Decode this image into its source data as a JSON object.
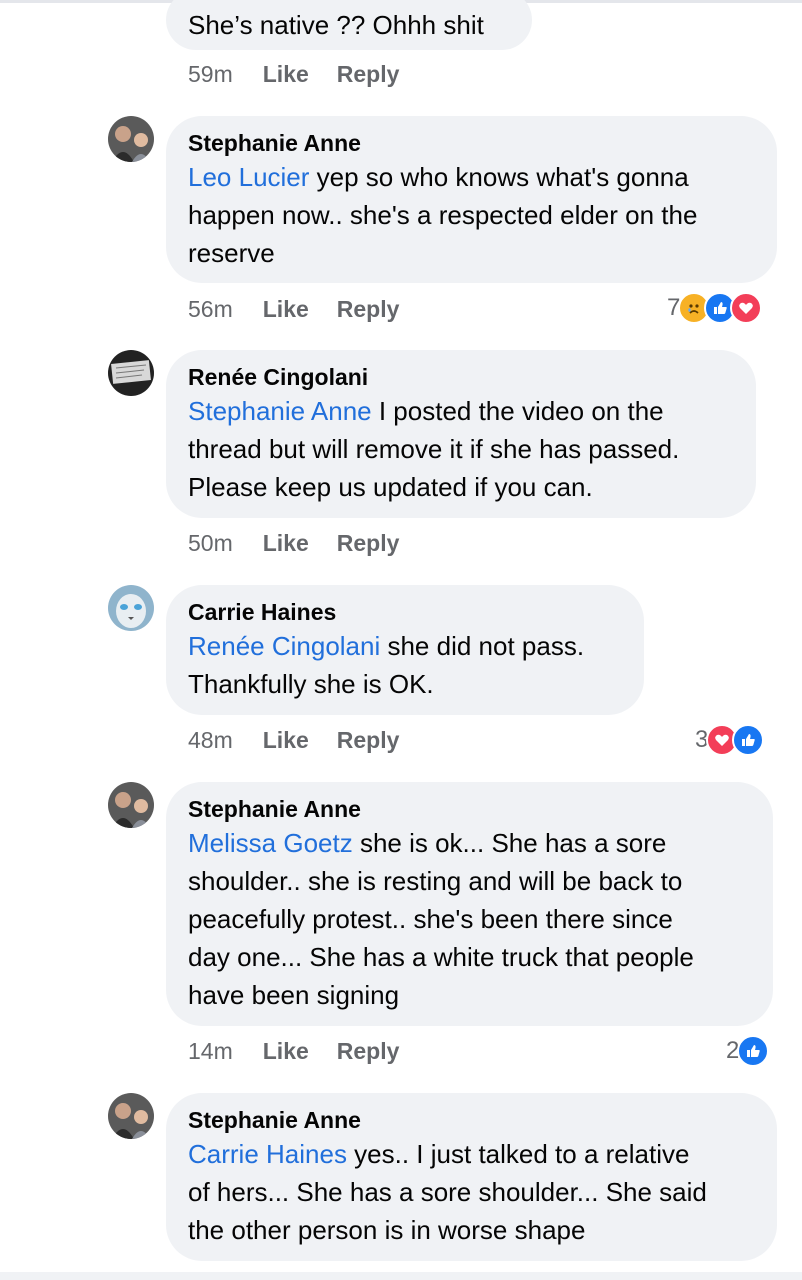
{
  "comments": [
    {
      "author": "",
      "mention": "",
      "text": "She’s native ?? Ohhh shit",
      "time": "59m",
      "like": "Like",
      "reply": "Reply",
      "reaction_count": ""
    },
    {
      "author": "Stephanie Anne",
      "mention": "Leo Lucier",
      "text_lines": [
        " yep so who knows what's gonna",
        "happen now.. she's a respected elder on the",
        "reserve"
      ],
      "time": "56m",
      "like": "Like",
      "reply": "Reply",
      "reaction_count": "7",
      "reaction_icons": [
        "sad-react-icon",
        "like-react-icon",
        "love-react-icon"
      ]
    },
    {
      "author": "Renée Cingolani",
      "mention": "Stephanie Anne",
      "text_lines": [
        " I posted the video on the",
        "thread but will remove it if she has passed.",
        "Please keep us updated if you can."
      ],
      "time": "50m",
      "like": "Like",
      "reply": "Reply",
      "reaction_count": ""
    },
    {
      "author": "Carrie Haines",
      "mention": "Renée Cingolani",
      "text_lines": [
        " she did not pass.",
        "Thankfully she is OK."
      ],
      "time": "48m",
      "like": "Like",
      "reply": "Reply",
      "reaction_count": "3",
      "reaction_icons": [
        "love-react-icon",
        "like-react-icon"
      ]
    },
    {
      "author": "Stephanie Anne",
      "mention": "Melissa Goetz",
      "text_lines": [
        " she is ok... She has a sore",
        "shoulder.. she is resting and will be back to",
        "peacefully protest.. she's been there since",
        "day one... She has a white truck that people",
        "have been signing"
      ],
      "time": "14m",
      "like": "Like",
      "reply": "Reply",
      "reaction_count": "2",
      "reaction_icons": [
        "like-react-icon"
      ]
    },
    {
      "author": "Stephanie Anne",
      "mention": "Carrie Haines",
      "text_lines": [
        " yes.. I just talked to a relative",
        "of hers... She has a sore shoulder... She said",
        "the other person is in worse shape"
      ],
      "time": "",
      "like": "",
      "reply": "",
      "reaction_count": ""
    }
  ],
  "colors": {
    "bubble": "#f0f2f5",
    "mention": "#216fdb",
    "meta": "#65676b",
    "like": "#1877f2",
    "love": "#f33e58",
    "sad": "#f7b125"
  }
}
